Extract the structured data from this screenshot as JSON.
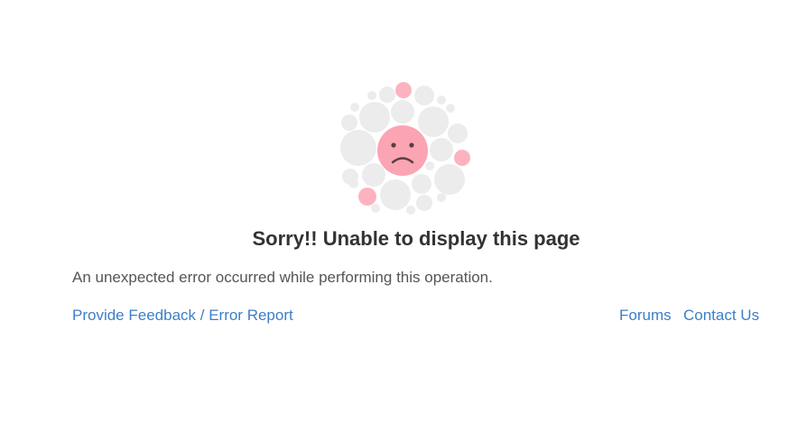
{
  "error": {
    "title": "Sorry!! Unable to display this page",
    "message": "An unexpected error occurred while performing this operation."
  },
  "links": {
    "feedback": "Provide Feedback / Error Report",
    "forums": "Forums",
    "contact": "Contact Us"
  },
  "colors": {
    "accent_link": "#3d7fc7",
    "face": "#fba4b3",
    "bubble_pink": "#fcb3bf",
    "bubble_gray": "#ececec"
  }
}
